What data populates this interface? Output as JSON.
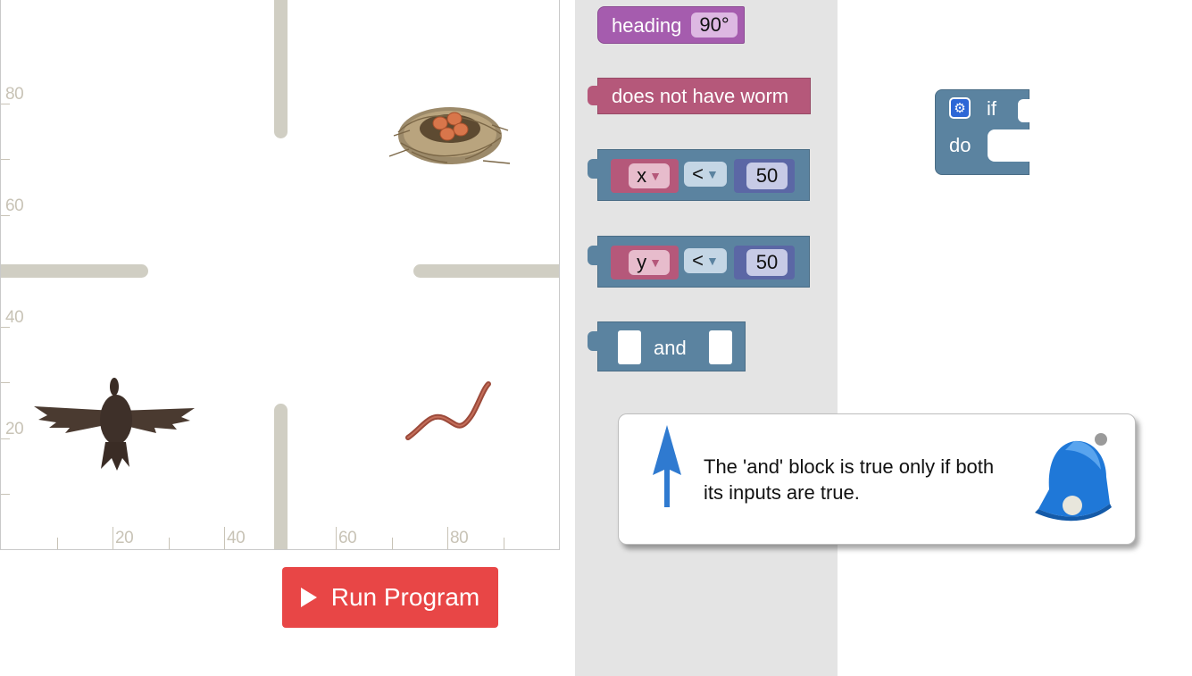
{
  "stage": {
    "y_ticks": [
      "80",
      "60",
      "40",
      "20"
    ],
    "x_ticks": [
      "20",
      "40",
      "60",
      "80"
    ],
    "sprites": [
      "bird-sprite",
      "nest-sprite",
      "worm-sprite"
    ]
  },
  "run_button": {
    "label": "Run Program",
    "icon": "play-icon"
  },
  "toolbox": {
    "heading_block": {
      "label": "heading",
      "value": "90°"
    },
    "condition_block": {
      "label": "does not have worm"
    },
    "compare_x": {
      "variable": "x",
      "operator": "<",
      "value": "50"
    },
    "compare_y": {
      "variable": "y",
      "operator": "<",
      "value": "50"
    },
    "and_block": {
      "label": "and"
    }
  },
  "workspace": {
    "if_block": {
      "if_label": "if",
      "do_label": "do",
      "icon": "gear-icon"
    }
  },
  "hint": {
    "text": "The 'and' block is true only if both its inputs are true.",
    "icons": [
      "up-arrow-icon",
      "bell-icon"
    ]
  },
  "colors": {
    "logic_block": "#5b83a0",
    "purple_block": "#a55cae",
    "pink_block": "#b5587a",
    "run_button": "#e84646",
    "toolbox_bg": "#e4e4e4"
  }
}
